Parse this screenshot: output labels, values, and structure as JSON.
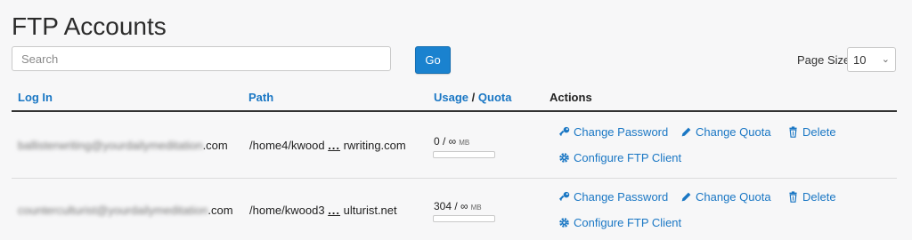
{
  "page": {
    "title": "FTP Accounts"
  },
  "search": {
    "placeholder": "Search",
    "go_label": "Go"
  },
  "page_size": {
    "label": "Page Size",
    "value": "10"
  },
  "columns": {
    "login": "Log In",
    "path": "Path",
    "usage": "Usage",
    "slash": "/",
    "quota": "Quota",
    "actions": "Actions"
  },
  "rows": [
    {
      "login_blurred": "ballisterwriting@yourdailymeditation",
      "login_suffix": ".com",
      "path_start": "/home4/kwood",
      "path_ellipsis": "...",
      "path_end": "rwriting.com",
      "usage": "0 / ∞",
      "usage_unit": "MB"
    },
    {
      "login_blurred": "counterculturist@yourdailymeditation",
      "login_suffix": ".com",
      "path_start": "/home/kwood3",
      "path_ellipsis": "...",
      "path_end": "ulturist.net",
      "usage": "304 / ∞",
      "usage_unit": "MB"
    }
  ],
  "actions": {
    "change_password": "Change Password",
    "change_quota": "Change Quota",
    "delete": "Delete",
    "configure": "Configure FTP Client"
  },
  "colors": {
    "link": "#1a77c4",
    "button": "#1a82cf"
  }
}
